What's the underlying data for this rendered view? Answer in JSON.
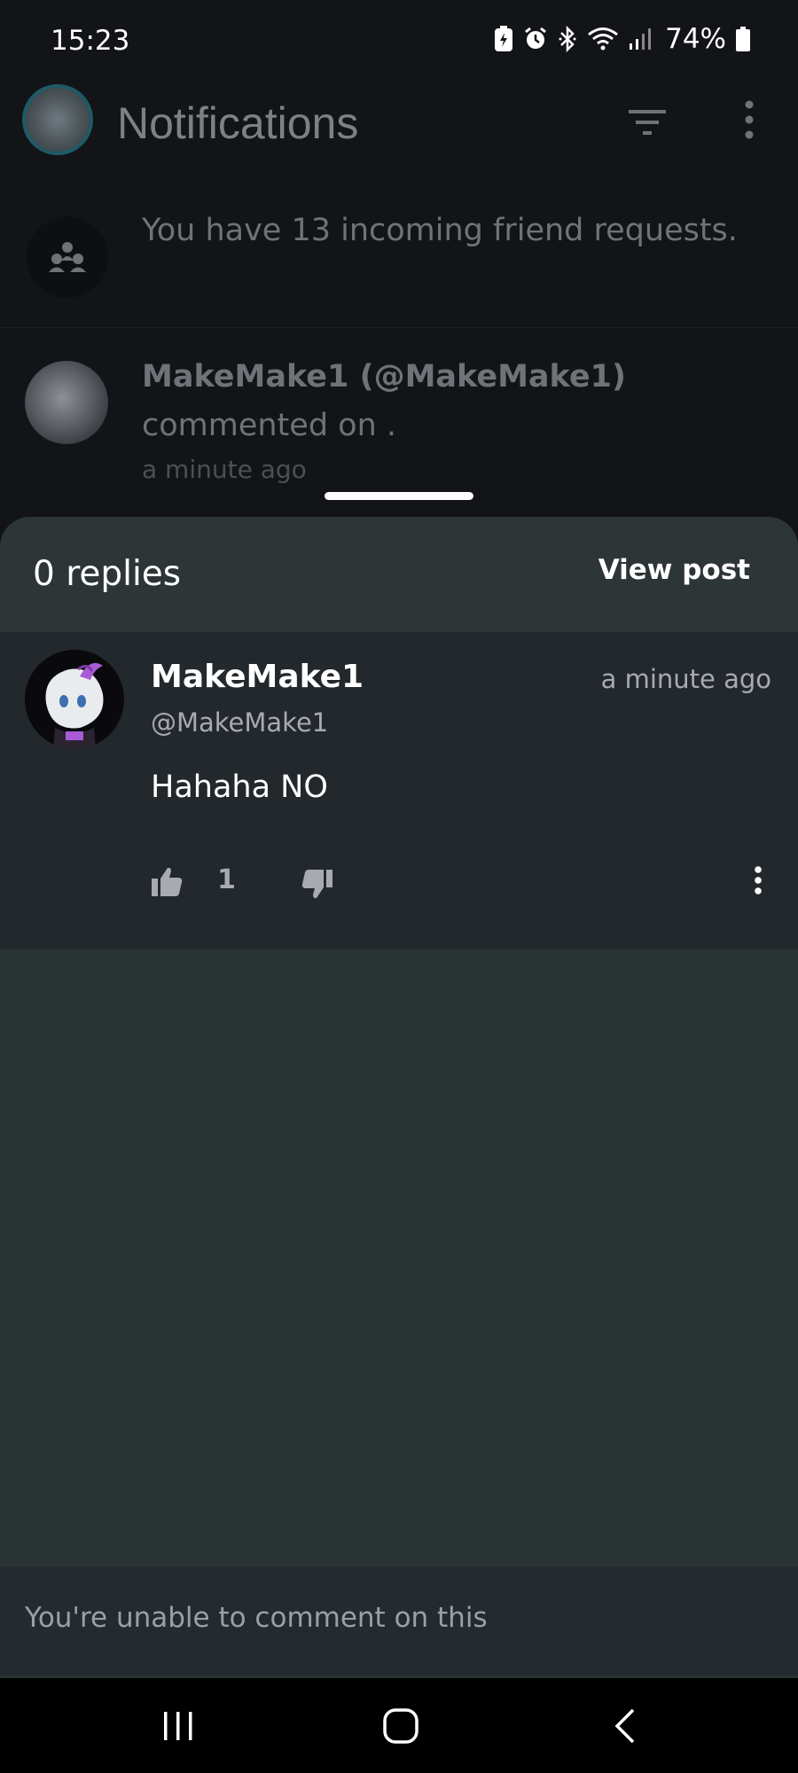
{
  "status_bar": {
    "time": "15:23",
    "battery_text": "74%",
    "icons": [
      "battery-saver-icon",
      "alarm-icon",
      "bluetooth-icon",
      "wifi-icon",
      "signal-icon",
      "battery-icon"
    ]
  },
  "header": {
    "title": "Notifications"
  },
  "notifications": {
    "friend_requests": "You have 13 incoming friend requests.",
    "comment": {
      "title": "MakeMake1 (@MakeMake1)",
      "body": "commented on .",
      "time": "a minute ago"
    }
  },
  "sheet": {
    "replies_label": "0 replies",
    "view_post_label": "View post",
    "comment": {
      "author": "MakeMake1",
      "handle": "@MakeMake1",
      "time": "a minute ago",
      "text": "Hahaha NO",
      "likes": "1"
    },
    "unable_text": "You're unable to comment on this"
  },
  "colors": {
    "background": "#121418",
    "sheet": "#2a3334",
    "comment_card": "#23282c",
    "text_primary": "#ffffff",
    "text_muted": "#a7abaf"
  }
}
